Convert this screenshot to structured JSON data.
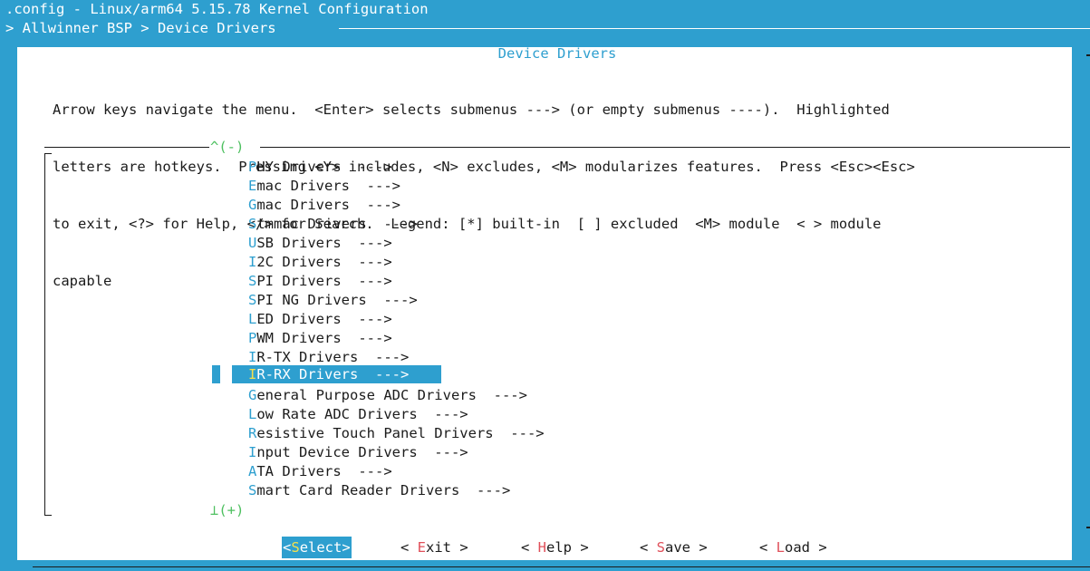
{
  "window": {
    "title": ".config - Linux/arm64 5.15.78 Kernel Configuration",
    "breadcrumb": "> Allwinner BSP > Device Drivers "
  },
  "dialog": {
    "title": "Device Drivers",
    "help_lines": [
      "Arrow keys navigate the menu.  <Enter> selects submenus ---> (or empty submenus ----).  Highlighted",
      "letters are hotkeys.  Pressing <Y> includes, <N> excludes, <M> modularizes features.  Press <Esc><Esc>",
      "to exit, <?> for Help, </> for Search.  Legend: [*] built-in  [ ] excluded  <M> module  < > module",
      "capable"
    ],
    "scroll_up": "^(-)",
    "scroll_down": "⊥(+)"
  },
  "menu": {
    "selected_index": 11,
    "items": [
      {
        "hotkey": "P",
        "rest": "HY Drivers  --->"
      },
      {
        "hotkey": "E",
        "rest": "mac Drivers  --->"
      },
      {
        "hotkey": "G",
        "rest": "mac Drivers  --->"
      },
      {
        "hotkey": "S",
        "rest": "tmmac Drivers  --->"
      },
      {
        "hotkey": "U",
        "rest": "SB Drivers  --->"
      },
      {
        "hotkey": "I",
        "rest": "2C Drivers  --->"
      },
      {
        "hotkey": "S",
        "rest": "PI Drivers  --->"
      },
      {
        "hotkey": "S",
        "rest": "PI NG Drivers  --->"
      },
      {
        "hotkey": "L",
        "rest": "ED Drivers  --->"
      },
      {
        "hotkey": "P",
        "rest": "WM Drivers  --->"
      },
      {
        "hotkey": "I",
        "rest": "R-TX Drivers  --->"
      },
      {
        "hotkey": "I",
        "rest": "R-RX Drivers  --->"
      },
      {
        "hotkey": "G",
        "rest": "eneral Purpose ADC Drivers  --->"
      },
      {
        "hotkey": "L",
        "rest": "ow Rate ADC Drivers  --->"
      },
      {
        "hotkey": "R",
        "rest": "esistive Touch Panel Drivers  --->"
      },
      {
        "hotkey": "I",
        "rest": "nput Device Drivers  --->"
      },
      {
        "hotkey": "A",
        "rest": "TA Drivers  --->"
      },
      {
        "hotkey": "S",
        "rest": "mart Card Reader Drivers  --->"
      }
    ]
  },
  "buttons": {
    "select": {
      "open": "<",
      "hotkey": "S",
      "rest": "elect",
      "close": ">"
    },
    "exit": {
      "open": "< ",
      "hotkey": "E",
      "rest": "xit",
      "close": " >"
    },
    "help": {
      "open": "< ",
      "hotkey": "H",
      "rest": "elp",
      "close": " >"
    },
    "save": {
      "open": "< ",
      "hotkey": "S",
      "rest": "ave",
      "close": " >"
    },
    "load": {
      "open": "< ",
      "hotkey": "L",
      "rest": "oad",
      "close": " >"
    }
  },
  "colors": {
    "background_blue": "#2e9fcf",
    "hotkey_blue": "#2e9fcf",
    "selected_hotkey": "#f4e04d",
    "button_hotkey": "#e0505a",
    "scroll_indicator": "#4ec060"
  }
}
